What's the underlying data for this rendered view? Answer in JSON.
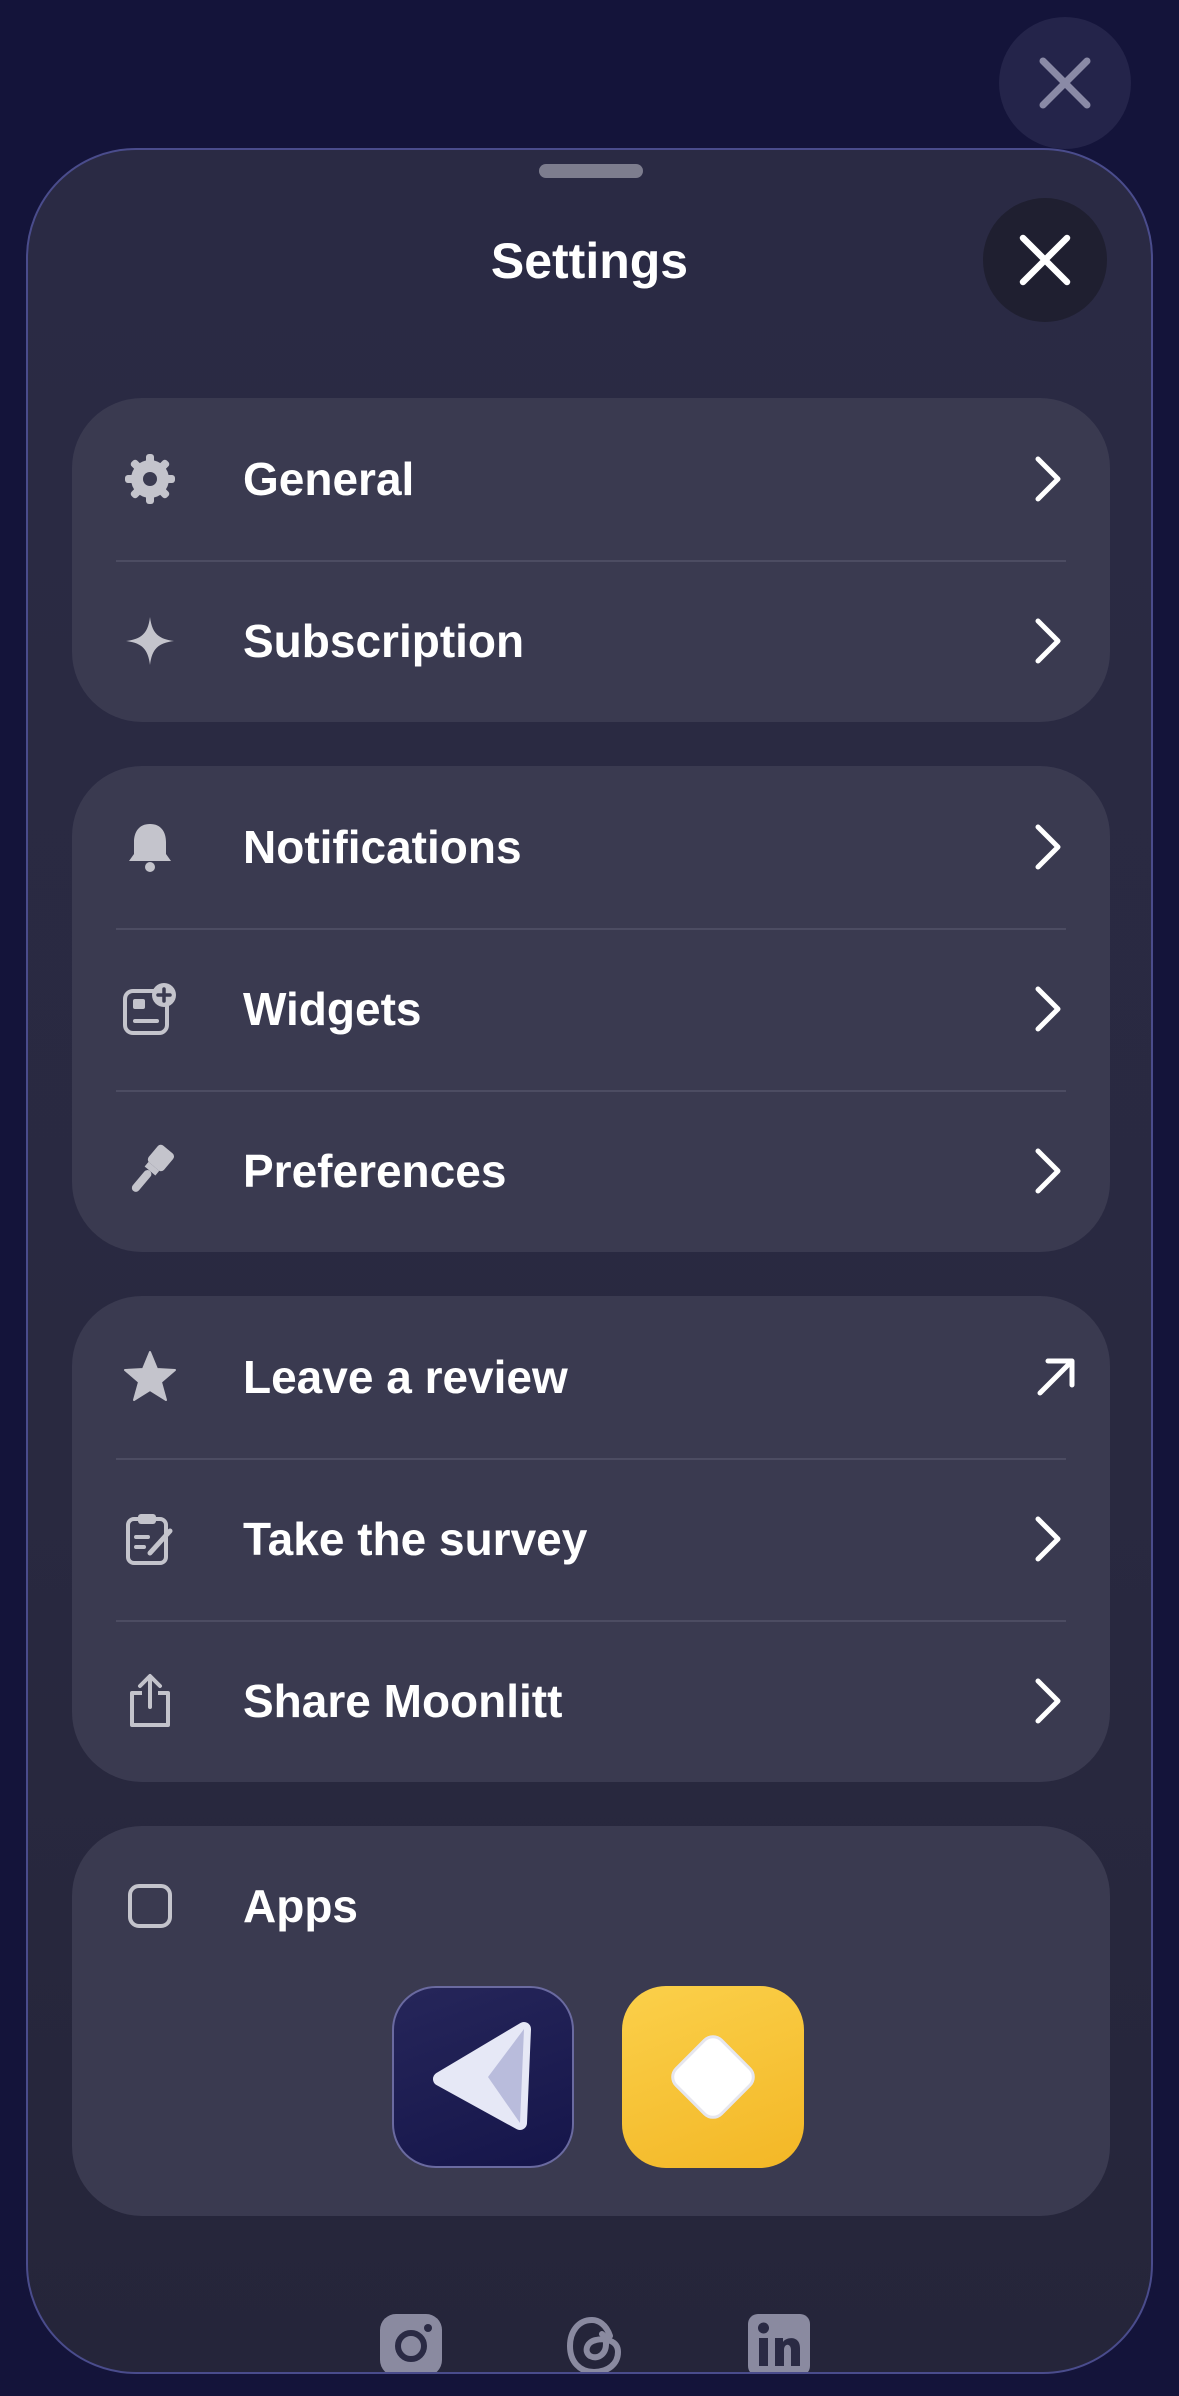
{
  "sheet": {
    "title": "Settings"
  },
  "groups": [
    {
      "items": [
        {
          "label": "General",
          "icon": "gear-icon",
          "accessory": "chevron-right-icon"
        },
        {
          "label": "Subscription",
          "icon": "sparkle-icon",
          "accessory": "chevron-right-icon"
        }
      ]
    },
    {
      "items": [
        {
          "label": "Notifications",
          "icon": "bell-icon",
          "accessory": "chevron-right-icon"
        },
        {
          "label": "Widgets",
          "icon": "widget-add-icon",
          "accessory": "chevron-right-icon"
        },
        {
          "label": "Preferences",
          "icon": "paintbrush-icon",
          "accessory": "chevron-right-icon"
        }
      ]
    },
    {
      "items": [
        {
          "label": "Leave a review",
          "icon": "star-icon",
          "accessory": "external-arrow-icon"
        },
        {
          "label": "Take the survey",
          "icon": "clipboard-edit-icon",
          "accessory": "chevron-right-icon"
        },
        {
          "label": "Share Moonlitt",
          "icon": "share-icon",
          "accessory": "chevron-right-icon"
        }
      ]
    }
  ],
  "apps": {
    "label": "Apps",
    "icon": "square-icon",
    "tiles": [
      {
        "name": "play-app-icon",
        "color": "#1c1c50"
      },
      {
        "name": "diamond-app-icon",
        "color": "#f6c131"
      }
    ]
  },
  "socials": [
    "instagram-icon",
    "threads-icon",
    "linkedin-icon"
  ],
  "colors": {
    "background": "#14143a",
    "sheet": "#2a2a44",
    "card": "#3a3a50",
    "icon": "#c4c4cc",
    "text": "#ffffff"
  }
}
